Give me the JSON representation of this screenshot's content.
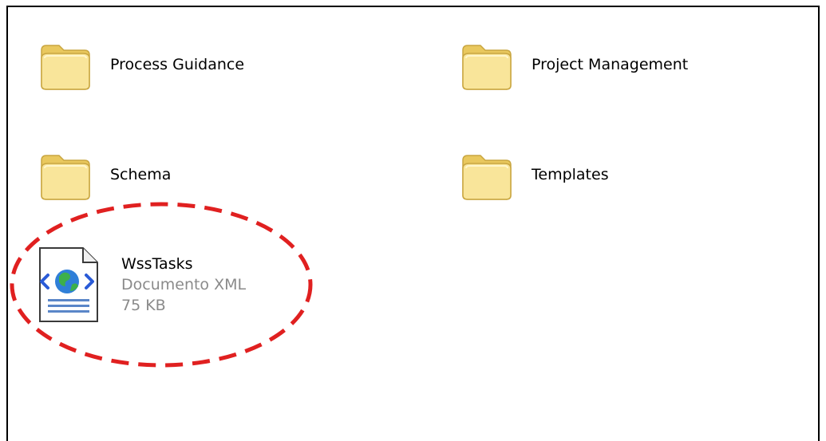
{
  "items": [
    {
      "name": "Process Guidance",
      "type": "folder",
      "icon": "folder-icon"
    },
    {
      "name": "Project Management",
      "type": "folder",
      "icon": "folder-icon"
    },
    {
      "name": "Schema",
      "type": "folder",
      "icon": "folder-icon"
    },
    {
      "name": "Templates",
      "type": "folder",
      "icon": "folder-icon"
    }
  ],
  "file": {
    "name": "WssTasks",
    "type_label": "Documento XML",
    "size": "75 KB",
    "icon": "xml-document-icon"
  },
  "colors": {
    "folder_fill": "#f7e08a",
    "folder_edge": "#c9a640",
    "annotation": "#e02020",
    "meta_text": "#8a8a8a"
  }
}
